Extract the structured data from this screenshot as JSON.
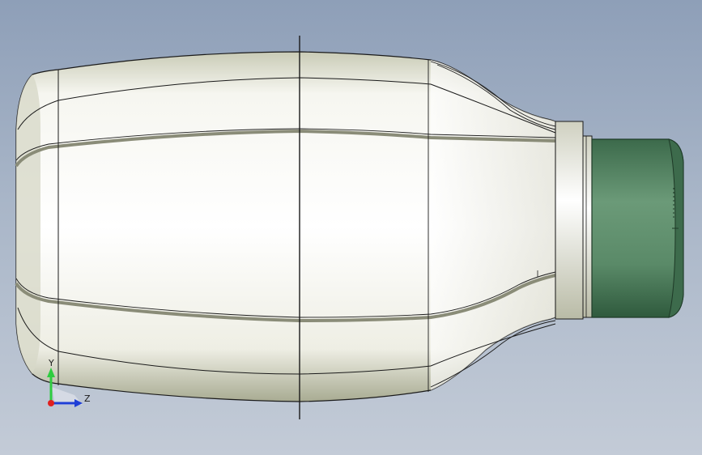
{
  "viewport": {
    "background_top": "#8e9fb8",
    "background_bottom": "#c3cbd7"
  },
  "model": {
    "body_color": "#f4f4ee",
    "body_shade": "#b9bba6",
    "cap_color": "#4f7d5d",
    "cap_edge": "#2d4a36",
    "edge_color": "#1a1a1a"
  },
  "triad": {
    "y_label": "Y",
    "z_label": "Z",
    "y_color": "#2ecc40",
    "z_color": "#1f3fd6",
    "x_color": "#e02020"
  }
}
